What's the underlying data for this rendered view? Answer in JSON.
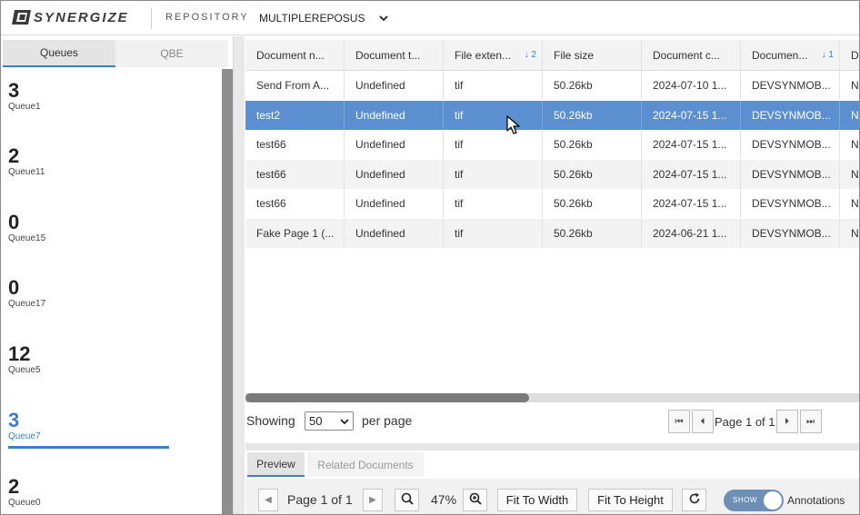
{
  "header": {
    "logo_text": "SYNERGIZE",
    "repository_label": "REPOSITORY",
    "repository_value": "MULTIPLEREPOSUS"
  },
  "left_tabs": [
    {
      "label": "Queues",
      "active": true
    },
    {
      "label": "QBE",
      "active": false
    }
  ],
  "queues": [
    {
      "count": "3",
      "name": "Queue1"
    },
    {
      "count": "2",
      "name": "Queue11"
    },
    {
      "count": "0",
      "name": "Queue15"
    },
    {
      "count": "0",
      "name": "Queue17"
    },
    {
      "count": "12",
      "name": "Queue5"
    },
    {
      "count": "3",
      "name": "Queue7",
      "selected": true
    },
    {
      "count": "2",
      "name": "Queue0"
    }
  ],
  "grid": {
    "columns": [
      {
        "label": "Document n..."
      },
      {
        "label": "Document t..."
      },
      {
        "label": "File exten...",
        "sort": "↓ 2"
      },
      {
        "label": "File size"
      },
      {
        "label": "Document c..."
      },
      {
        "label": "Documen...",
        "sort": "↓ 1"
      },
      {
        "label": "Do"
      }
    ],
    "rows": [
      [
        "Send From A...",
        "Undefined",
        "tif",
        "50.26kb",
        "2024-07-10 1...",
        "DEVSYNMOB...",
        "No"
      ],
      [
        "test2",
        "Undefined",
        "tif",
        "50.26kb",
        "2024-07-15 1...",
        "DEVSYNMOB...",
        "No"
      ],
      [
        "test66",
        "Undefined",
        "tif",
        "50.26kb",
        "2024-07-15 1...",
        "DEVSYNMOB...",
        "No"
      ],
      [
        "test66",
        "Undefined",
        "tif",
        "50.26kb",
        "2024-07-15 1...",
        "DEVSYNMOB...",
        "No"
      ],
      [
        "test66",
        "Undefined",
        "tif",
        "50.26kb",
        "2024-07-15 1...",
        "DEVSYNMOB...",
        "No"
      ],
      [
        "Fake Page 1 (...",
        "Undefined",
        "tif",
        "50.26kb",
        "2024-06-21 1...",
        "DEVSYNMOB...",
        "No"
      ]
    ],
    "selected_row": 1
  },
  "pager": {
    "showing_label": "Showing",
    "per_page_value": "50",
    "per_page_label": "per page",
    "page_text": "Page 1 of 1"
  },
  "preview": {
    "tabs": [
      {
        "label": "Preview",
        "active": true
      },
      {
        "label": "Related Documents",
        "active": false
      }
    ],
    "page_text": "Page 1 of 1",
    "zoom": "47%",
    "fit_width_label": "Fit To Width",
    "fit_height_label": "Fit To Height",
    "toggle_label": "SHOW",
    "annotations_label": "Annotations"
  },
  "colors": {
    "accent": "#3b7fc4",
    "selected_row": "#5b8fcf"
  }
}
